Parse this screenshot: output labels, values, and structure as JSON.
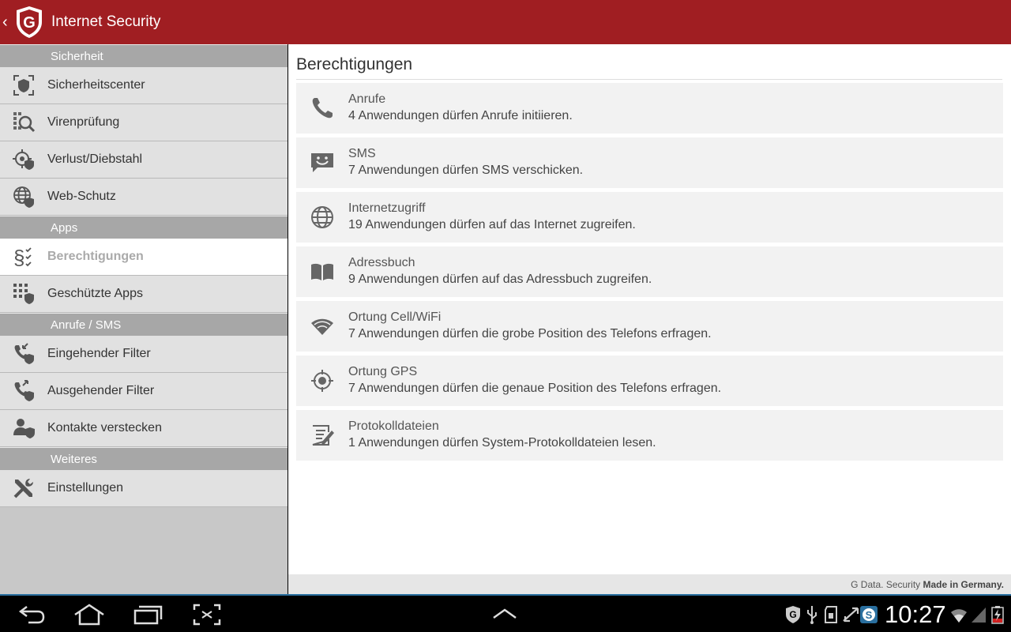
{
  "app": {
    "title": "Internet Security",
    "logo_letter": "G",
    "accent": "#a01e22"
  },
  "sidebar": {
    "sections": [
      {
        "header": "Sicherheit",
        "items": [
          {
            "label": "Sicherheitscenter",
            "icon": "shield-target-icon"
          },
          {
            "label": "Virenprüfung",
            "icon": "virus-scan-icon"
          },
          {
            "label": "Verlust/Diebstahl",
            "icon": "locate-shield-icon"
          },
          {
            "label": "Web-Schutz",
            "icon": "globe-shield-icon"
          }
        ]
      },
      {
        "header": "Apps",
        "items": [
          {
            "label": "Berechtigungen",
            "icon": "permissions-check-icon",
            "selected": true
          },
          {
            "label": "Geschützte Apps",
            "icon": "apps-shield-icon"
          }
        ]
      },
      {
        "header": "Anrufe / SMS",
        "items": [
          {
            "label": "Eingehender Filter",
            "icon": "incoming-filter-icon"
          },
          {
            "label": "Ausgehender Filter",
            "icon": "outgoing-filter-icon"
          },
          {
            "label": "Kontakte verstecken",
            "icon": "hide-contact-icon"
          }
        ]
      },
      {
        "header": "Weiteres",
        "items": [
          {
            "label": "Einstellungen",
            "icon": "tools-icon"
          }
        ]
      }
    ]
  },
  "main": {
    "title": "Berechtigungen",
    "permissions": [
      {
        "title": "Anrufe",
        "desc": "4 Anwendungen dürfen Anrufe initiieren.",
        "icon": "phone-icon"
      },
      {
        "title": "SMS",
        "desc": "7 Anwendungen dürfen SMS verschicken.",
        "icon": "sms-icon"
      },
      {
        "title": "Internetzugriff",
        "desc": "19 Anwendungen dürfen auf das Internet zugreifen.",
        "icon": "globe-icon"
      },
      {
        "title": "Adressbuch",
        "desc": "9 Anwendungen dürfen auf das Adressbuch zugreifen.",
        "icon": "book-icon"
      },
      {
        "title": "Ortung Cell/WiFi",
        "desc": "7 Anwendungen dürfen die grobe Position des Telefons erfragen.",
        "icon": "wifi-icon"
      },
      {
        "title": "Ortung GPS",
        "desc": "7 Anwendungen dürfen die genaue Position des Telefons erfragen.",
        "icon": "gps-icon"
      },
      {
        "title": "Protokolldateien",
        "desc": "1 Anwendungen dürfen System-Protokolldateien lesen.",
        "icon": "log-file-icon"
      }
    ],
    "footer_prefix": "G Data. Security ",
    "footer_bold": "Made in Germany."
  },
  "system_bar": {
    "clock": "10:27"
  }
}
